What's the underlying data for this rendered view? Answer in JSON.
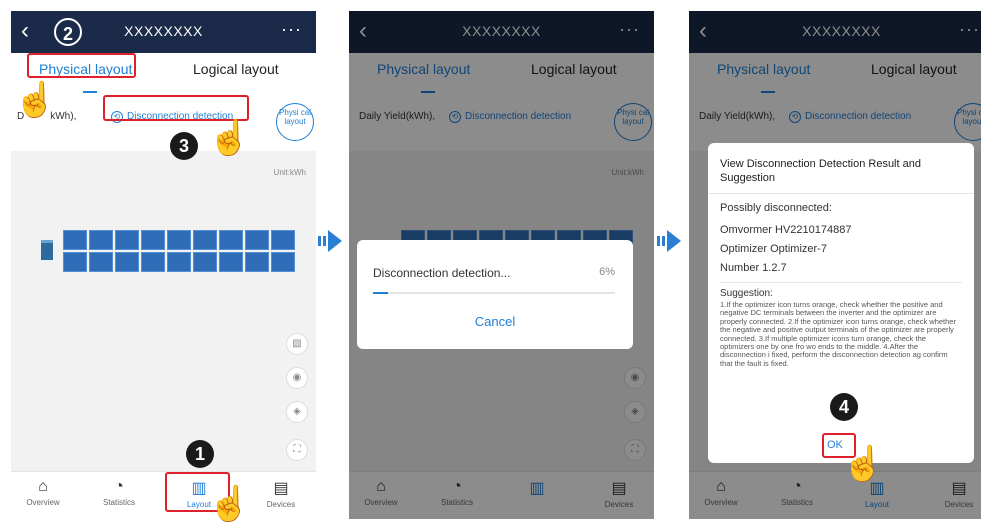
{
  "screen": {
    "title": "XXXXXXXX",
    "tabs": {
      "physical": "Physical layout",
      "logical": "Logical layout"
    },
    "daily_yield": "Daily Yield(kWh),",
    "daily_yield_partial": "D",
    "daily_yield_tail": "kWh),",
    "disconnection_detection": "Disconnection detection",
    "physical_layout_btn": "Physi cal layout",
    "unit": "Unit:kWh",
    "nav": {
      "overview": "Overview",
      "statistics": "Statistics",
      "layout": "Layout",
      "devices": "Devices"
    }
  },
  "callouts": {
    "c1": "1",
    "c2": "2",
    "c3": "3",
    "c4": "4"
  },
  "progress_dialog": {
    "text": "Disconnection detection...",
    "percent_label": "6%",
    "percent": 6,
    "cancel": "Cancel"
  },
  "result_dialog": {
    "title": "View Disconnection Detection Result and Suggestion",
    "possibly": "Possibly disconnected:",
    "line1": "Omvormer HV2210174887",
    "line2": "Optimizer Optimizer-7",
    "line3": "Number 1.2.7",
    "suggestion_title": "Suggestion:",
    "suggestion_text": "1.If the optimizer icon turns orange, check whether the positive and negative DC terminals between the inverter and the optimizer are properly connected. 2.If the optimizer icon turns orange, check whether the negative and positive output terminals of the optimizer are properly connected. 3.If multiple optimizer icons turn orange, check the optimizers one by one fro  wo ends to the middle. 4.After the disconnection i  fixed, perform the disconnection detection ag   confirm that the fault is fixed.",
    "ok": "OK"
  },
  "colors": {
    "topbar": "#1b2a48",
    "accent": "#1f7fd6",
    "highlight": "#e0202a"
  }
}
